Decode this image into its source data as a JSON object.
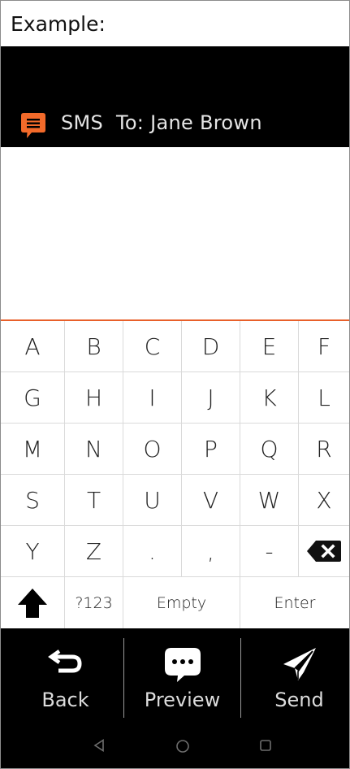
{
  "caption": "Example:",
  "header": {
    "app_icon": "sms-chat-bubble-icon",
    "channel": "SMS",
    "recipient_label": "To: Jane Brown",
    "accent_color": "#e8602a"
  },
  "message": {
    "text": ""
  },
  "keyboard": {
    "rows": [
      [
        "A",
        "B",
        "C",
        "D",
        "E",
        "F"
      ],
      [
        "G",
        "H",
        "I",
        "J",
        "K",
        "L"
      ],
      [
        "M",
        "N",
        "O",
        "P",
        "Q",
        "R"
      ],
      [
        "S",
        "T",
        "U",
        "V",
        "W",
        "X"
      ],
      [
        "Y",
        "Z",
        ".",
        ",",
        "-"
      ]
    ],
    "backspace_icon": "backspace-icon",
    "shift_icon": "shift-arrow-icon",
    "symbols_label": "?123",
    "empty_label": "Empty",
    "enter_label": "Enter"
  },
  "actions": {
    "back_label": "Back",
    "preview_label": "Preview",
    "send_label": "Send"
  },
  "navigation": {
    "back_icon": "nav-back-triangle-icon",
    "home_icon": "nav-home-circle-icon",
    "recents_icon": "nav-recents-square-icon"
  }
}
